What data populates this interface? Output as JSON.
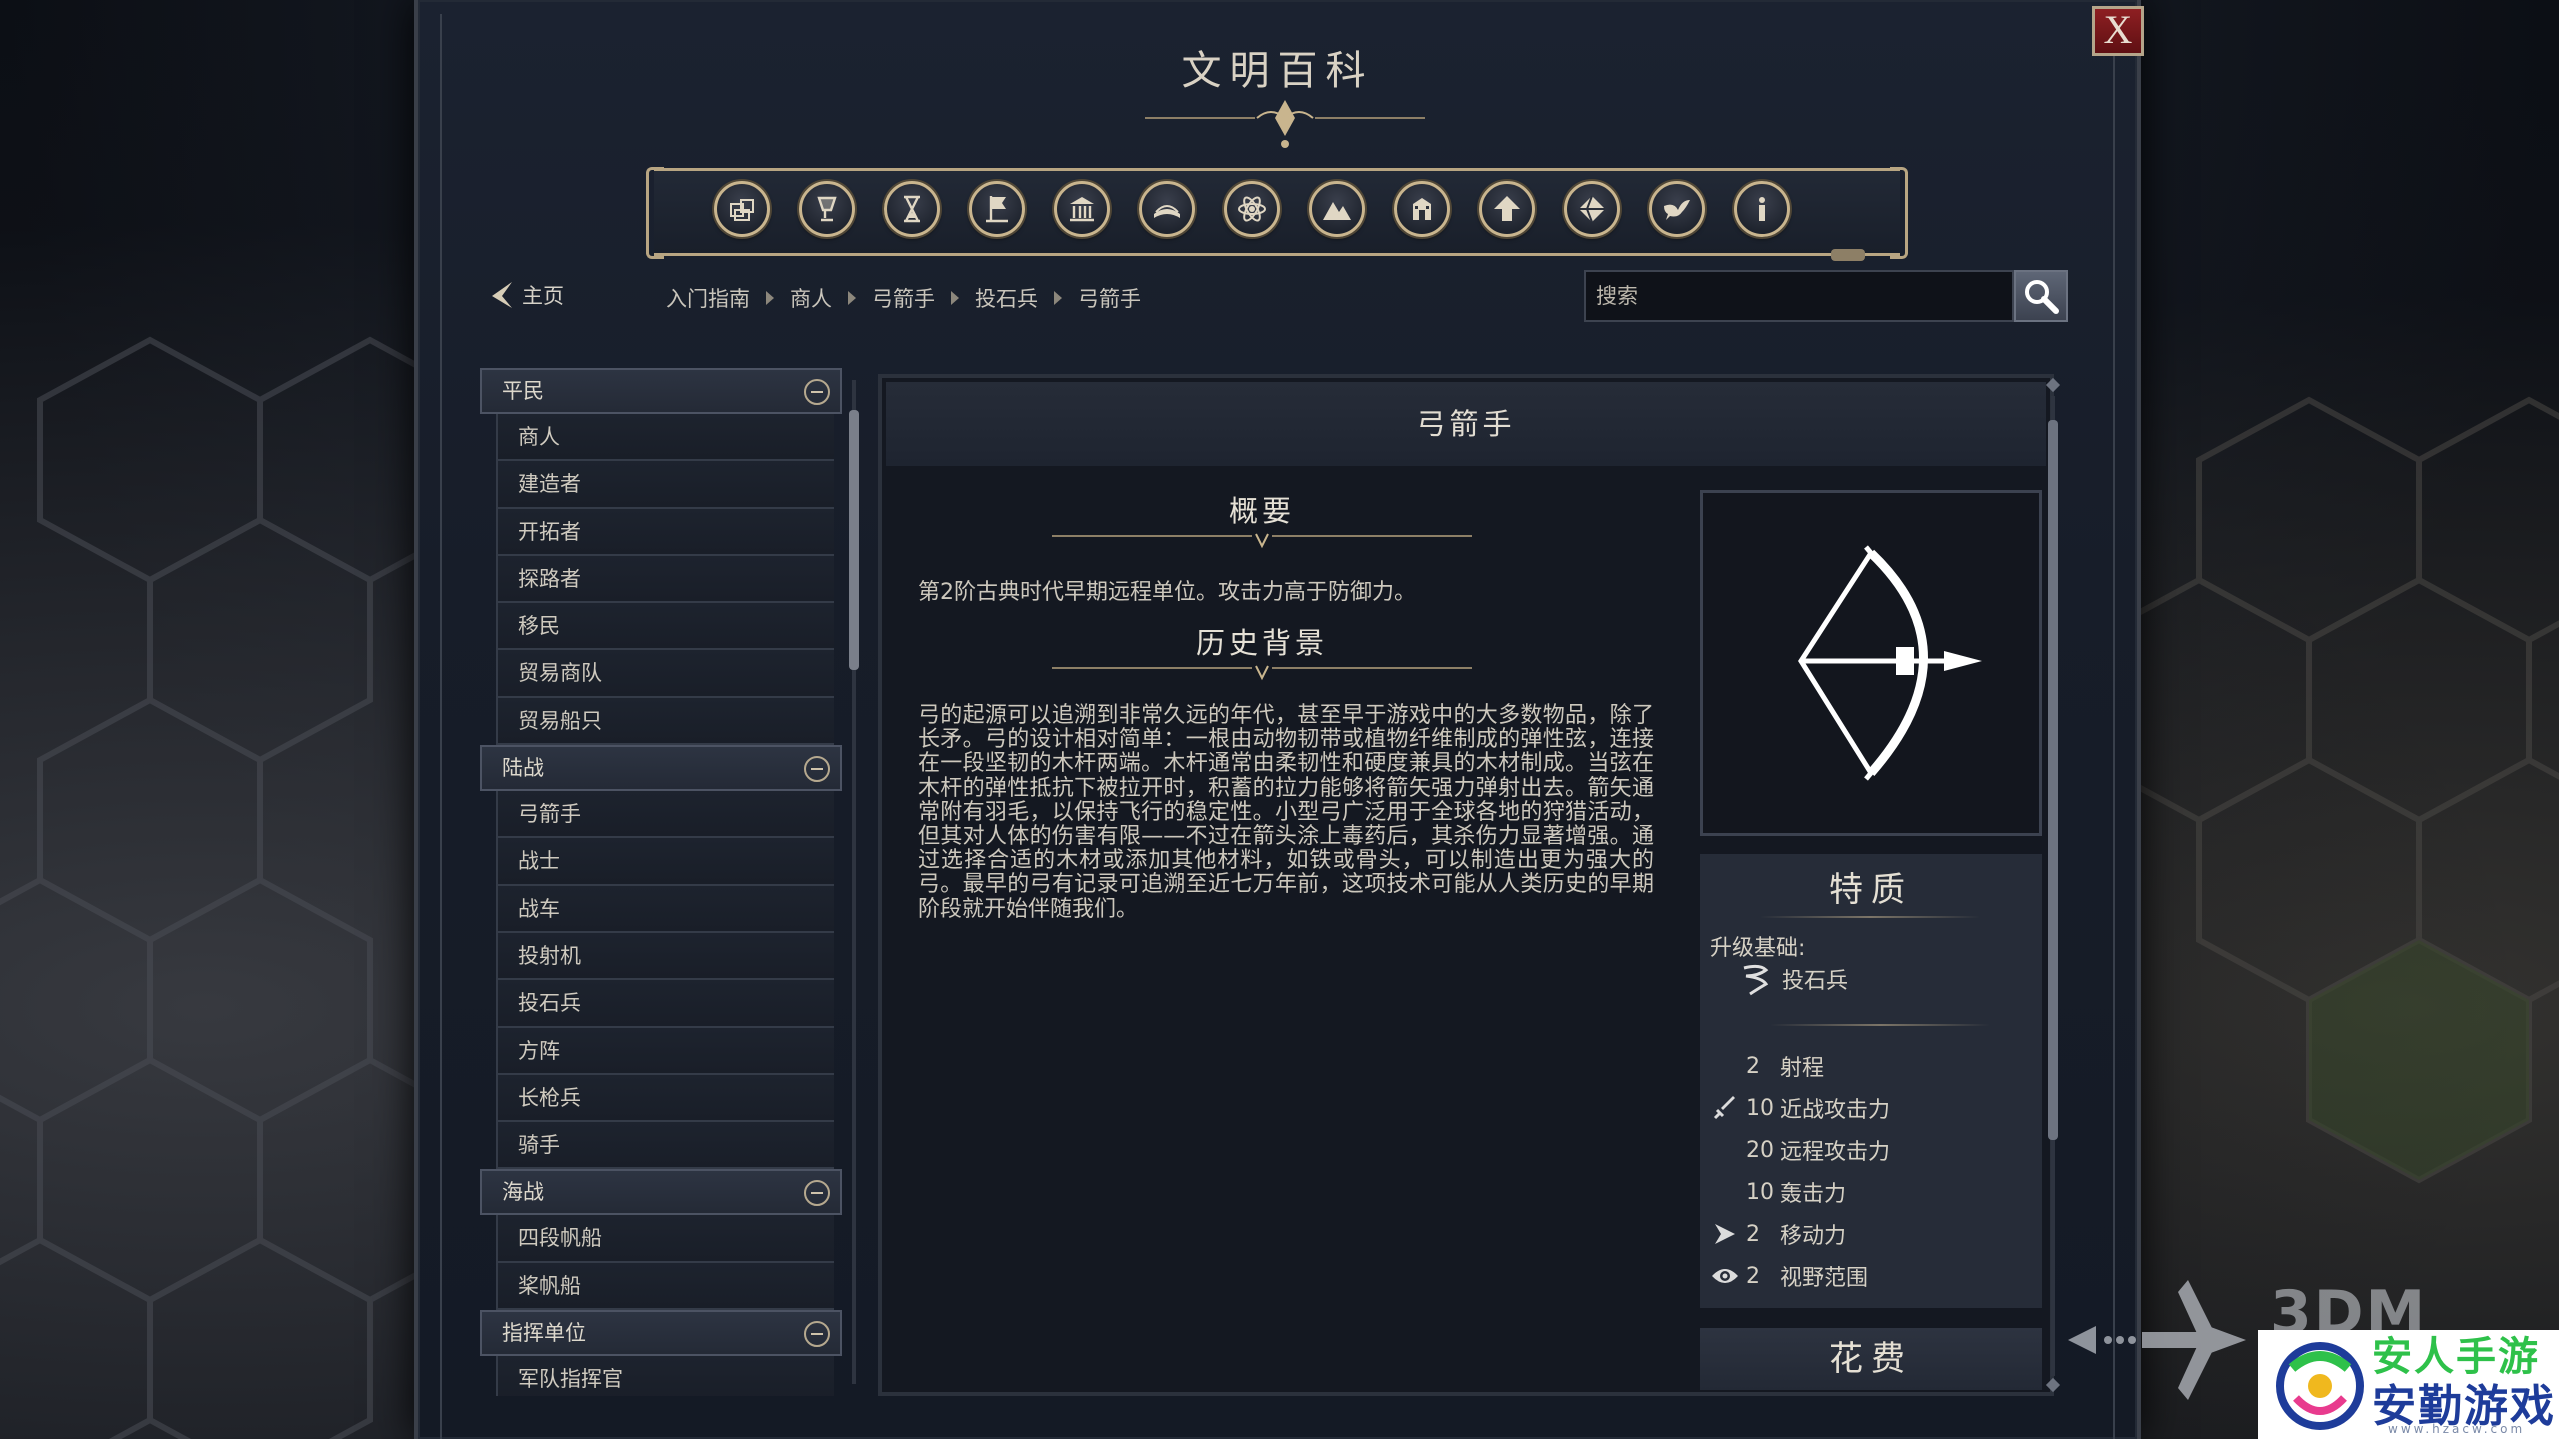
{
  "window": {
    "title": "文明百科",
    "close_label": "X"
  },
  "nav": {
    "home_label": "主页",
    "search_placeholder": "搜索",
    "breadcrumb": [
      "入门指南",
      "商人",
      "弓箭手",
      "投石兵",
      "弓箭手"
    ]
  },
  "category_icons": [
    "crate-icon",
    "goblet-icon",
    "hourglass-icon",
    "flag-icon",
    "temple-icon",
    "book-icon",
    "atom-icon",
    "mountain-icon",
    "building-icon",
    "upgrade-arrow-icon",
    "terrain-icon",
    "dove-icon",
    "info-icon"
  ],
  "tree": [
    {
      "label": "平民",
      "items": [
        "商人",
        "建造者",
        "开拓者",
        "探路者",
        "移民",
        "贸易商队",
        "贸易船只"
      ]
    },
    {
      "label": "陆战",
      "items": [
        "弓箭手",
        "战士",
        "战车",
        "投射机",
        "投石兵",
        "方阵",
        "长枪兵",
        "骑手"
      ]
    },
    {
      "label": "海战",
      "items": [
        "四段帆船",
        "桨帆船"
      ]
    },
    {
      "label": "指挥单位",
      "items": [
        "军队指挥官"
      ]
    }
  ],
  "article": {
    "unit_name": "弓箭手",
    "summary_heading": "概要",
    "summary_text": "第2阶古典时代早期远程单位。攻击力高于防御力。",
    "history_heading": "历史背景",
    "history_text": "弓的起源可以追溯到非常久远的年代，甚至早于游戏中的大多数物品，除了长矛。弓的设计相对简单：一根由动物韧带或植物纤维制成的弹性弦，连接在一段坚韧的木杆两端。木杆通常由柔韧性和硬度兼具的木材制成。当弦在木杆的弹性抵抗下被拉开时，积蓄的拉力能够将箭矢强力弹射出去。箭矢通常附有羽毛，以保持飞行的稳定性。小型弓广泛用于全球各地的狩猎活动，但其对人体的伤害有限——不过在箭头涂上毒药后，其杀伤力显著增强。通过选择合适的木材或添加其他材料，如铁或骨头，可以制造出更为强大的弓。最早的弓有记录可追溯至近七万年前，这项技术可能从人类历史的早期阶段就开始伴随我们。",
    "traits_heading": "特质",
    "upgrade_label": "升级基础:",
    "upgrade_unit": "投石兵",
    "stats": [
      {
        "icon": "none",
        "value": "2",
        "label": "射程"
      },
      {
        "icon": "melee-sword-icon",
        "value": "10",
        "label": "近战攻击力"
      },
      {
        "icon": "none",
        "value": "20",
        "label": "远程攻击力"
      },
      {
        "icon": "none",
        "value": "10",
        "label": "轰击力"
      },
      {
        "icon": "movement-arrow-icon",
        "value": "2",
        "label": "移动力"
      },
      {
        "icon": "eye-icon",
        "value": "2",
        "label": "视野范围"
      }
    ],
    "cost_heading": "花费"
  },
  "watermark": {
    "brand": "3DM",
    "green_text": "安人手游",
    "site_name": "安勤游戏网",
    "site_url": "www.hzacw.com"
  },
  "colors": {
    "gold_trim": "#c9b58e",
    "close_red": "#8e1f22",
    "panel_bg": "#141821"
  }
}
